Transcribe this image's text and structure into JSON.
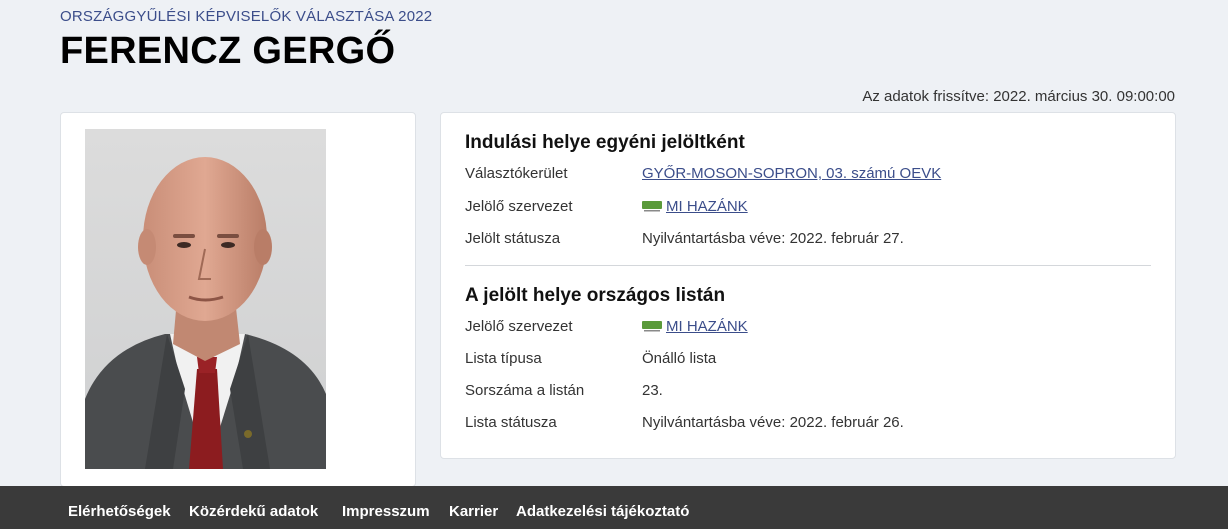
{
  "header": {
    "election_title": "ORSZÁGGYŰLÉSI KÉPVISELŐK VÁLASZTÁSA 2022",
    "candidate_name": "FERENCZ GERGŐ",
    "updated": "Az adatok frissítve: 2022. március 30. 09:00:00"
  },
  "individual": {
    "title": "Indulási helye egyéni jelöltként",
    "rows": [
      {
        "label": "Választókerület",
        "value": "GYŐR-MOSON-SOPRON, 03. számú OEVK"
      },
      {
        "label": "Jelölő szervezet",
        "value": "MI HAZÁNK"
      },
      {
        "label": "Jelölt státusza",
        "value": "Nyilvántartásba véve: 2022. február 27."
      }
    ]
  },
  "national_list": {
    "title": "A jelölt helye országos listán",
    "rows": [
      {
        "label": "Jelölő szervezet",
        "value": "MI HAZÁNK"
      },
      {
        "label": "Lista típusa",
        "value": "Önálló lista"
      },
      {
        "label": "Sorszáma a listán",
        "value": "23."
      },
      {
        "label": "Lista státusza",
        "value": "Nyilvántartásba véve: 2022. február 26."
      }
    ]
  },
  "footer": {
    "links": [
      "Elérhetőségek",
      "Közérdekű adatok",
      "Impresszum",
      "Karrier",
      "Adatkezelési tájékoztató"
    ]
  },
  "colors": {
    "link": "#3b4d8a",
    "page_bg": "#eef1f5",
    "footer_bg": "#3a3a3a",
    "party_logo": "#5a9a3a"
  }
}
